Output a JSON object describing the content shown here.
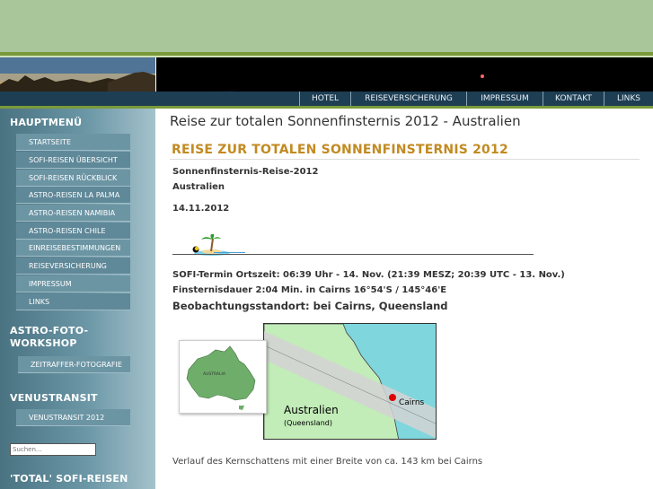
{
  "nav": {
    "items": [
      "HOTEL",
      "REISEVERSICHERUNG",
      "IMPRESSUM",
      "KONTAKT",
      "LINKS"
    ]
  },
  "sidebar": {
    "hauptmenu_title": "HAUPTMENÜ",
    "hauptmenu_items": [
      "STARTSEITE",
      "SOFI-REISEN ÜBERSICHT",
      "SOFI-REISEN RÜCKBLICK",
      "ASTRO-REISEN LA PALMA",
      "ASTRO-REISEN NAMIBIA",
      "ASTRO-REISEN CHILE",
      "EINREISEBESTIMMUNGEN",
      "REISEVERSICHERUNG",
      "IMPRESSUM",
      "LINKS"
    ],
    "workshop_title_line1": "ASTRO-FOTO-",
    "workshop_title_line2": "WORKSHOP",
    "workshop_items": [
      "ZEITRAFFER-FOTOGRAFIE"
    ],
    "venus_title": "VENUSTRANSIT",
    "venus_items": [
      "VENUSTRANSIT 2012"
    ],
    "search_placeholder": "Suchen...",
    "total_title": "'TOTAL' SOFI-REISEN"
  },
  "main": {
    "page_title": "Reise zur totalen Sonnenfinsternis 2012 - Australien",
    "article_title": "REISE ZUR TOTALEN SONNENFINSTERNIS 2012",
    "line1": "Sonnenfinsternis-Reise-2012",
    "line2": "Australien",
    "date": "14.11.2012",
    "sofi_termin": "SOFI-Termin Ortszeit: 06:39 Uhr - 14. Nov. (21:39 MESZ; 20:39 UTC - 13. Nov.)",
    "finsternis": "Finsternisdauer 2:04 Min. in Cairns 16°54'S / 145°46'E",
    "standort": "Beobachtungsstandort: bei Cairns, Queensland",
    "caption": "Verlauf des Kernschattens mit einer Breite von ca. 143 km bei Cairns"
  },
  "map": {
    "main_label": "Australien",
    "sub_label": "(Queensland)",
    "city_label": "Cairns",
    "inset_label": "AUSTRALIA",
    "colors": {
      "sea": "#7fd6dd",
      "land": "#c2ecb8",
      "shadow_band": "#d4d4d4",
      "city_dot": "#e00000"
    }
  },
  "icons": {
    "separator": "palm-island-icon"
  }
}
